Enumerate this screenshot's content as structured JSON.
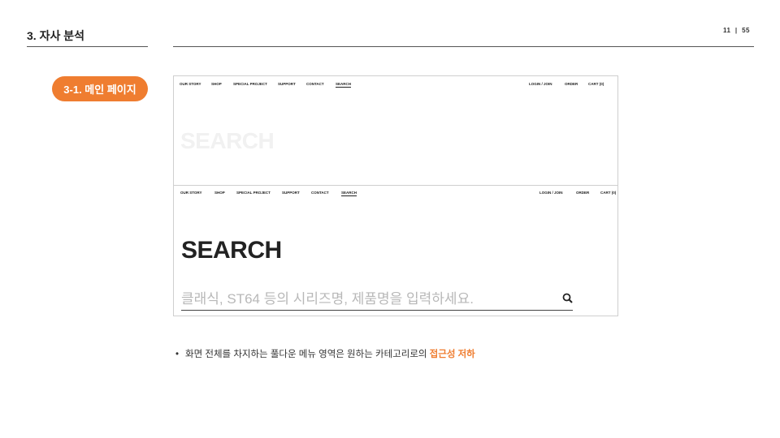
{
  "section": {
    "title": "3. 자사 분석",
    "page_current": "11",
    "page_separator": "|",
    "page_total": "55"
  },
  "subsection": {
    "label": "3-1. 메인 페이지"
  },
  "screenshot": {
    "nav_top": {
      "left": [
        "OUR STORY",
        "SHOP",
        "SPECIAL PROJECT",
        "SUPPORT",
        "CONTACT",
        "SEARCH"
      ],
      "right": [
        "LOGIN / JOIN",
        "ORDER",
        "CART (0)"
      ]
    },
    "ghost_title": "SEARCH",
    "nav_bottom": {
      "left": [
        "OUR STORY",
        "SHOP",
        "SPECIAL PROJECT",
        "SUPPORT",
        "CONTACT",
        "SEARCH"
      ],
      "right": [
        "LOGIN / JOIN",
        "ORDER",
        "CART (0)"
      ]
    },
    "title": "SEARCH",
    "search_placeholder": "클래식, ST64 등의 시리즈명, 제품명을 입력하세요.",
    "search_icon": "search-icon"
  },
  "note": {
    "bullet": "•",
    "text": "화면 전체를 차지하는 풀다운 메뉴 영역은 원하는 카테고리로의 ",
    "highlight": "접근성 저하"
  },
  "colors": {
    "accent": "#ef7d30"
  }
}
